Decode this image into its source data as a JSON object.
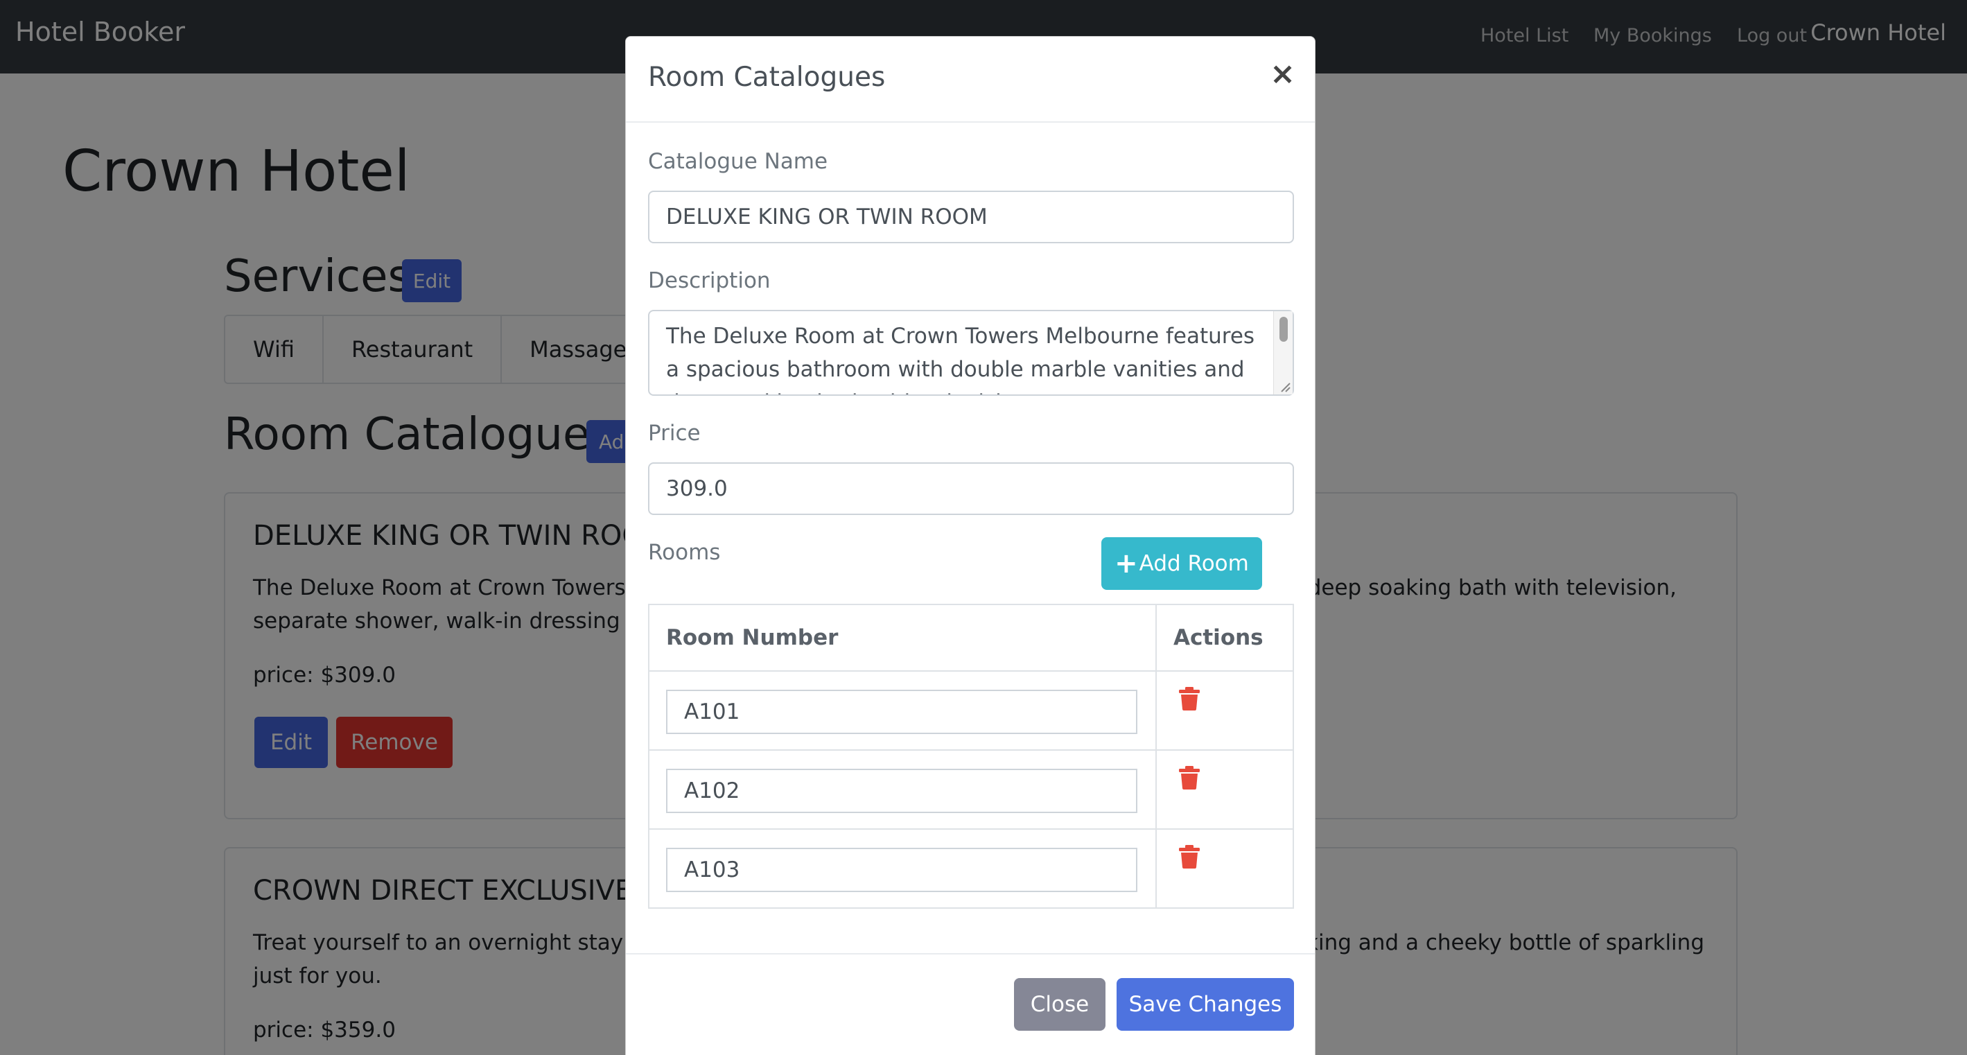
{
  "navbar": {
    "brand": "Hotel Booker",
    "links": [
      "Hotel List",
      "My Bookings",
      "Log out"
    ],
    "user": "Crown Hotel"
  },
  "page": {
    "title": "Crown Hotel",
    "services_title": "Services",
    "services_edit_label": "Edit",
    "services": [
      "Wifi",
      "Restaurant",
      "Massage"
    ],
    "catalogues_title": "Room Catalogues",
    "catalogues_add_label": "Ad",
    "cards": [
      {
        "title": "DELUXE KING OR TWIN ROO",
        "desc_line1_left": "The Deluxe Room at Crown Towers M",
        "desc_line1_right": "nd deep soaking bath with television,",
        "desc_line2_left": "separate shower, walk-in dressing roo",
        "price": "price: $309.0",
        "edit_label": "Edit",
        "remove_label": "Remove"
      },
      {
        "title": "CROWN DIRECT EXCLUSIVE",
        "desc_line1_left": "Treat yourself to an overnight stay at c",
        "desc_line1_right": "parking and a cheeky bottle of sparkling",
        "desc_line2_left": "just for you.",
        "price": "price: $359.0"
      }
    ]
  },
  "modal": {
    "title": "Room Catalogues",
    "close_symbol": "×",
    "catalogue_name_label": "Catalogue Name",
    "catalogue_name_value": "DELUXE KING OR TWIN ROOM",
    "description_label": "Description",
    "description_value": "The Deluxe Room at Crown Towers Melbourne features a spacious bathroom with double marble vanities and deep soaking bath with television,",
    "price_label": "Price",
    "price_value": "309.0",
    "rooms_label": "Rooms",
    "add_room_label": "Add Room",
    "table_headers": [
      "Room Number",
      "Actions"
    ],
    "rooms": [
      "A101",
      "A102",
      "A103"
    ],
    "close_label": "Close",
    "save_label": "Save Changes"
  },
  "colors": {
    "navbar": "#343a40",
    "primary": "#4e73df",
    "danger": "#e3342f",
    "info": "#36b9cc",
    "secondary": "#858796",
    "trash": "#e74a3b"
  }
}
